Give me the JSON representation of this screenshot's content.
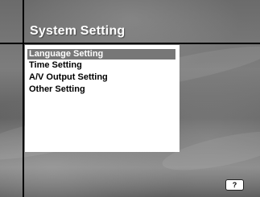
{
  "header": {
    "title": "System Setting"
  },
  "menu": {
    "items": [
      {
        "label": "Language Setting",
        "selected": true
      },
      {
        "label": "Time Setting",
        "selected": false
      },
      {
        "label": "A/V Output Setting",
        "selected": false
      },
      {
        "label": "Other Setting",
        "selected": false
      }
    ]
  },
  "footer": {
    "help_label": "?"
  },
  "colors": {
    "selected_bg": "#777777",
    "panel_bg": "#ffffff",
    "title_text": "#ffffff"
  },
  "icons": {
    "help": "help-button-icon"
  }
}
